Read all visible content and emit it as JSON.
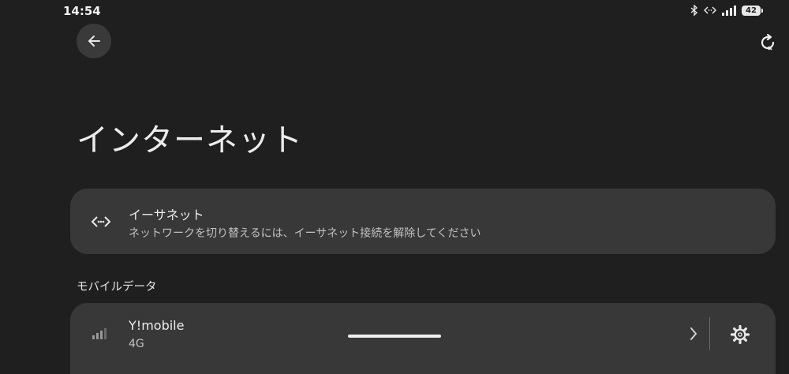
{
  "status_bar": {
    "time": "14:54",
    "battery": "42",
    "icons": [
      "bluetooth-icon",
      "ethernet-icon",
      "signal-icon",
      "battery-icon"
    ]
  },
  "header": {
    "back_icon": "arrow-left-icon",
    "refresh_icon": "refresh-icon",
    "title": "インターネット"
  },
  "ethernet": {
    "icon": "ethernet-icon",
    "title": "イーサネット",
    "subtitle": "ネットワークを切り替えるには、イーサネット接続を解除してください"
  },
  "mobile_data": {
    "section_title": "モバイルデータ",
    "carrier": "Y!mobile",
    "network_type": "4G",
    "signal_icon": "signal-icon",
    "chevron_icon": "chevron-right-icon",
    "settings_icon": "gear-icon"
  },
  "colors": {
    "background": "#1f1f1f",
    "card": "#383838",
    "text": "#ececec"
  }
}
